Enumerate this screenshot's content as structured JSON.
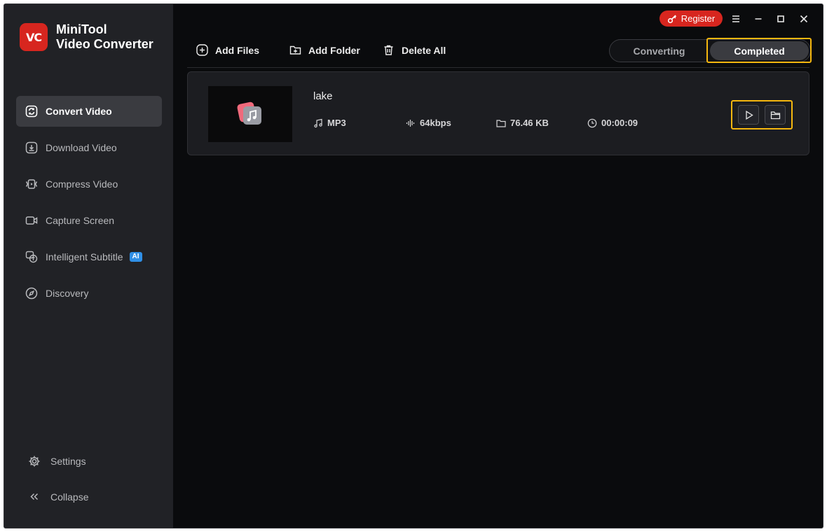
{
  "app": {
    "name_line1": "MiniTool",
    "name_line2": "Video Converter",
    "logo_text": "VC"
  },
  "titlebar": {
    "register_label": "Register"
  },
  "sidebar": {
    "items": [
      {
        "label": "Convert Video",
        "icon": "convert-icon",
        "active": true
      },
      {
        "label": "Download Video",
        "icon": "download-icon"
      },
      {
        "label": "Compress Video",
        "icon": "compress-icon"
      },
      {
        "label": "Capture Screen",
        "icon": "camera-icon"
      },
      {
        "label": "Intelligent Subtitle",
        "icon": "subtitle-icon",
        "badge": "AI"
      },
      {
        "label": "Discovery",
        "icon": "compass-icon"
      }
    ],
    "settings_label": "Settings",
    "collapse_label": "Collapse"
  },
  "toolbar": {
    "add_files": "Add Files",
    "add_folder": "Add Folder",
    "delete_all": "Delete All"
  },
  "tabs": {
    "converting": "Converting",
    "completed": "Completed",
    "active": "completed"
  },
  "file": {
    "name": "lake",
    "format": "MP3",
    "bitrate": "64kbps",
    "size": "76.46 KB",
    "duration": "00:00:09"
  },
  "colors": {
    "accent_red": "#d7261f",
    "highlight": "#f5b70f",
    "ai_badge": "#2f8fe6"
  }
}
